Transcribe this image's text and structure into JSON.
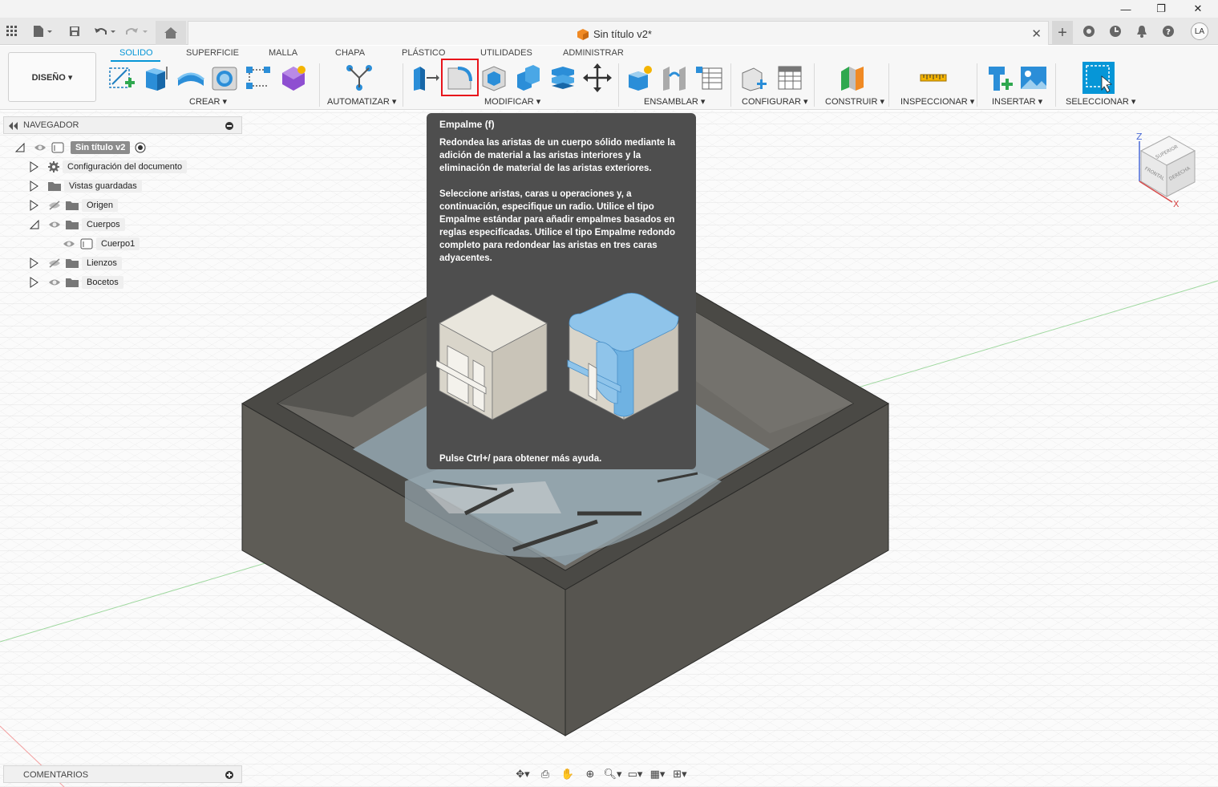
{
  "window": {
    "minimize": "—",
    "restore": "❐",
    "close": "✕"
  },
  "appbar": {
    "doc_title": "Sin título v2*",
    "avatar": "LA",
    "icons": [
      "grid-icon",
      "file-icon",
      "save-icon",
      "undo-icon",
      "redo-icon",
      "home-icon"
    ]
  },
  "ribbon": {
    "workspace": "DISEÑO ▾",
    "tabs": [
      "SOLIDO",
      "SUPERFICIE",
      "MALLA",
      "CHAPA",
      "PLÁSTICO",
      "UTILIDADES",
      "ADMINISTRAR"
    ],
    "active_tab": "SOLIDO",
    "groups": {
      "crear": "CREAR ▾",
      "automatizar": "AUTOMATIZAR ▾",
      "modificar": "MODIFICAR ▾",
      "ensamblar": "ENSAMBLAR ▾",
      "configurar": "CONFIGURAR ▾",
      "construir": "CONSTRUIR ▾",
      "inspeccionar": "INSPECCIONAR ▾",
      "insertar": "INSERTAR ▾",
      "seleccionar": "SELECCIONAR ▾"
    }
  },
  "navigator": {
    "title": "NAVEGADOR",
    "root": "Sin título v2",
    "items": [
      {
        "label": "Configuración del documento"
      },
      {
        "label": "Vistas guardadas"
      },
      {
        "label": "Origen"
      },
      {
        "label": "Cuerpos"
      },
      {
        "label": "Cuerpo1"
      },
      {
        "label": "Lienzos"
      },
      {
        "label": "Bocetos"
      }
    ]
  },
  "tooltip": {
    "title": "Empalme (f)",
    "paragraph1": "Redondea las aristas de un cuerpo sólido mediante la adición de material a las aristas interiores y la eliminación de material de las aristas exteriores.",
    "paragraph2": "Seleccione aristas, caras u operaciones y, a continuación, especifique un radio. Utilice el tipo Empalme estándar para añadir empalmes basados en reglas especificadas. Utilice el tipo Empalme redondo completo para redondear las aristas en tres caras adyacentes.",
    "footer": "Pulse Ctrl+/ para obtener más ayuda."
  },
  "viewcube": {
    "top": "SUPERIOR",
    "front": "FRONTAL",
    "right": "DERECHA",
    "z": "Z",
    "x": "X"
  },
  "comments": {
    "label": "COMENTARIOS"
  },
  "colors": {
    "accent": "#0696d7",
    "highlight": "#e8141b",
    "tooltip_bg": "#4e4e4e",
    "body": "#5e5c56"
  }
}
